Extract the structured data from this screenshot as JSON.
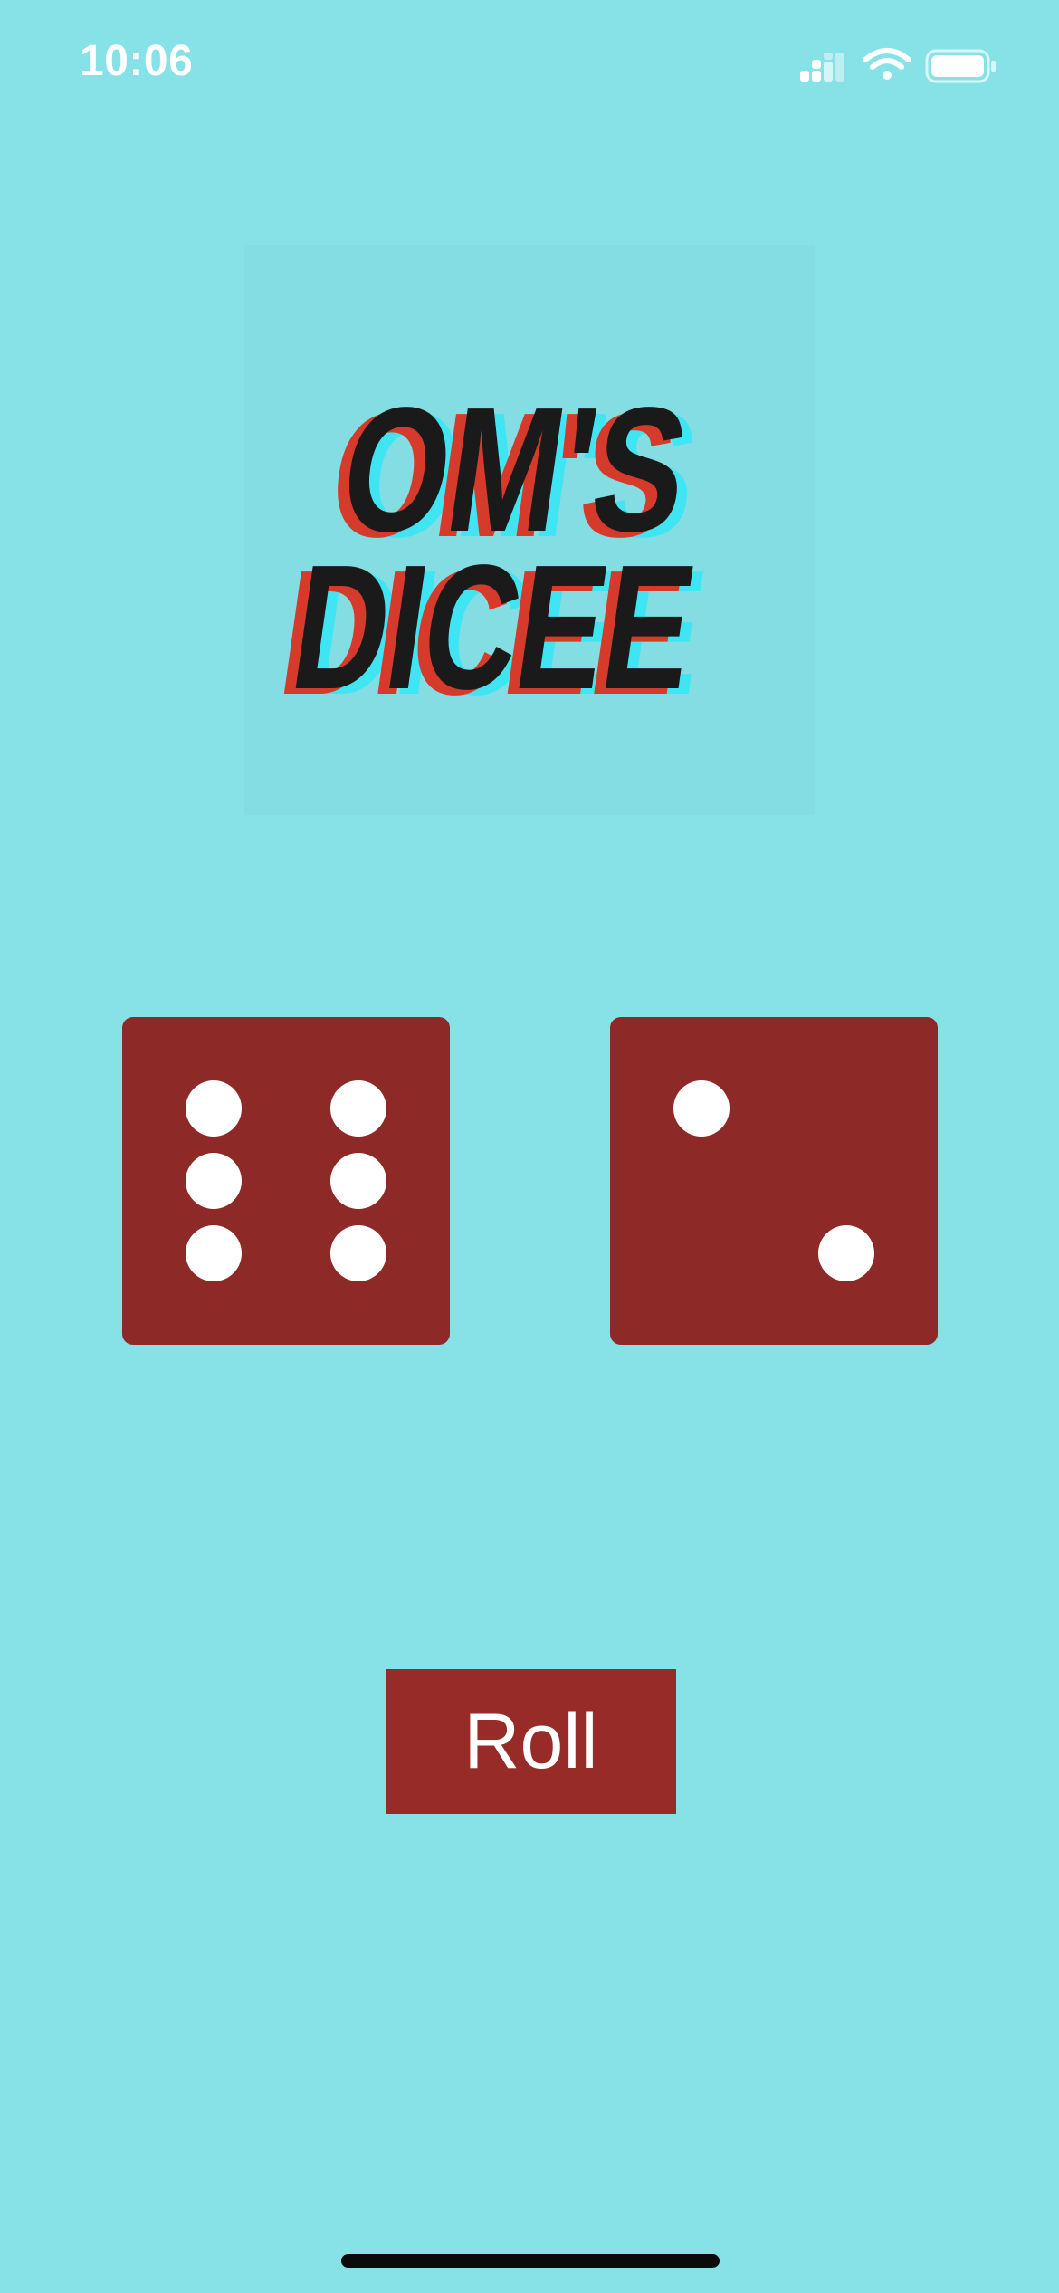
{
  "status_bar": {
    "time": "10:06",
    "icons": [
      "cellular-signal-icon",
      "wifi-icon",
      "battery-icon"
    ]
  },
  "logo": {
    "text_line1": "OM'S",
    "text_line2": "DICEE"
  },
  "dice": {
    "left": {
      "value": 6
    },
    "right": {
      "value": 2
    },
    "color": "#8D2927",
    "pip_color": "#FFFFFF"
  },
  "roll_button": {
    "label": "Roll",
    "color": "#962B27"
  },
  "colors": {
    "background": "#87E2E7",
    "accent": "#962B27"
  }
}
